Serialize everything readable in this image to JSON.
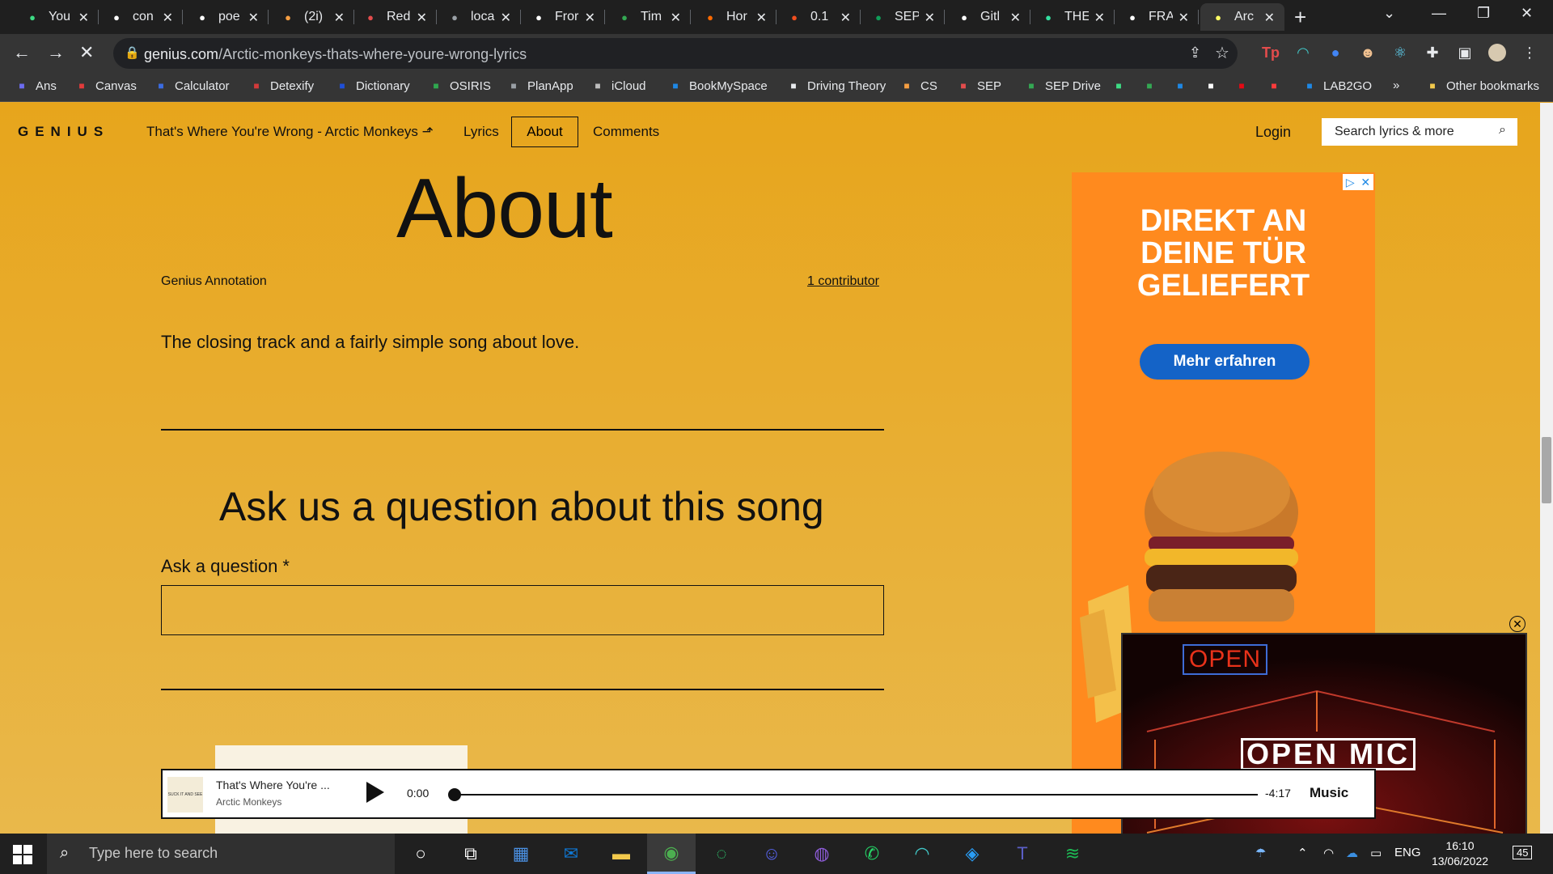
{
  "browser": {
    "tabs": [
      {
        "title": "You",
        "favicon": "leaf-icon",
        "color": "#3ddc84"
      },
      {
        "title": "con",
        "favicon": "google-icon",
        "color": "#ffffff"
      },
      {
        "title": "poe",
        "favicon": "google-icon",
        "color": "#ffffff"
      },
      {
        "title": "(2i)",
        "favicon": "dots-icon",
        "color": "#f59e42"
      },
      {
        "title": "Red",
        "favicon": "doc-icon",
        "color": "#e34c4c"
      },
      {
        "title": "loca",
        "favicon": "globe-icon",
        "color": "#9aa0a6"
      },
      {
        "title": "Fror",
        "favicon": "github-icon",
        "color": "#ffffff"
      },
      {
        "title": "Tim",
        "favicon": "drive-icon",
        "color": "#34a853"
      },
      {
        "title": "Hor",
        "favicon": "arc-icon",
        "color": "#ff6a00"
      },
      {
        "title": "0.1",
        "favicon": "figma-icon",
        "color": "#f24e1e"
      },
      {
        "title": "SEP",
        "favicon": "plus-icon",
        "color": "#0f9d58"
      },
      {
        "title": "Gitl",
        "favicon": "github-icon",
        "color": "#ffffff"
      },
      {
        "title": "THE",
        "favicon": "tripadvisor-icon",
        "color": "#34e0a1"
      },
      {
        "title": "FRA",
        "favicon": "f-icon",
        "color": "#ffffff"
      },
      {
        "title": "Arc",
        "favicon": "genius-icon",
        "color": "#ffff64",
        "active": true
      }
    ],
    "url_domain": "genius.com",
    "url_path": "/Arctic-monkeys-thats-where-youre-wrong-lyrics",
    "bookmarks": [
      {
        "label": "Ans",
        "icon": "ans-icon",
        "color": "#6c6cf0"
      },
      {
        "label": "Canvas",
        "icon": "canvas-icon",
        "color": "#e23b3b"
      },
      {
        "label": "Calculator",
        "icon": "calculator-icon",
        "color": "#3b6ce2"
      },
      {
        "label": "Detexify",
        "icon": "detexify-icon",
        "color": "#d23a3a"
      },
      {
        "label": "Dictionary",
        "icon": "dictionary-icon",
        "color": "#1f4fd8"
      },
      {
        "label": "OSIRIS",
        "icon": "osiris-icon",
        "color": "#2fa84f"
      },
      {
        "label": "PlanApp",
        "icon": "globe-icon",
        "color": "#9aa0a6"
      },
      {
        "label": "iCloud",
        "icon": "apple-icon",
        "color": "#bdbdbd"
      },
      {
        "label": "BookMySpace",
        "icon": "bookmyspace-icon",
        "color": "#1e88e5"
      },
      {
        "label": "Driving Theory",
        "icon": "page-icon",
        "color": "#e8eaed"
      },
      {
        "label": "CS",
        "icon": "dots-icon",
        "color": "#f59e42"
      },
      {
        "label": "SEP",
        "icon": "doc-icon",
        "color": "#e34c4c"
      },
      {
        "label": "SEP Drive",
        "icon": "drive-icon",
        "color": "#34a853"
      },
      {
        "label": "LAB2GO",
        "icon": "z-icon",
        "color": "#1e88e5"
      },
      {
        "label": "Other bookmarks",
        "icon": "folder-icon",
        "color": "#f2c94c"
      }
    ],
    "more_bookmarks": "»"
  },
  "site": {
    "logo": "GENIUS",
    "song_link": "That's Where You're Wrong - Arctic Monkeys",
    "nav": {
      "lyrics": "Lyrics",
      "about": "About",
      "comments": "Comments"
    },
    "login": "Login",
    "search_placeholder": "Search lyrics & more"
  },
  "about": {
    "heading": "About",
    "annotation_label": "Genius Annotation",
    "contributors": "1 contributor",
    "text": "The closing track and a fairly simple song about love."
  },
  "question": {
    "heading": "Ask us a question about this song",
    "label": "Ask a question *"
  },
  "ad": {
    "headline_1": "DIREKT AN",
    "headline_2": "DEINE TÜR",
    "headline_3": "GELIEFERT",
    "button": "Mehr erfahren"
  },
  "video": {
    "sign": "OPEN",
    "title": "OPEN MIC"
  },
  "player": {
    "title": "That's Where You're ...",
    "artist": "Arctic Monkeys",
    "current_time": "0:00",
    "remaining_time": "-4:17",
    "brand": "Music",
    "progress": 0,
    "album_art_text": "SUCK IT AND SEE"
  },
  "taskbar": {
    "search_placeholder": "Type here to search",
    "apps": [
      "cortana-icon",
      "task-view-icon",
      "calendar-icon",
      "outlook-icon",
      "file-explorer-icon",
      "chrome-icon",
      "loop-icon",
      "discord-icon",
      "github-desktop-icon",
      "whatsapp-icon",
      "arc-icon",
      "vscode-icon",
      "teams-icon",
      "spotify-icon"
    ],
    "language": "ENG",
    "time": "16:10",
    "date": "13/06/2022",
    "notifications": "45"
  },
  "colors": {
    "page_bg": "#e8a82a",
    "ad_bg": "#ff8a1e",
    "ad_button": "#1463c7"
  }
}
